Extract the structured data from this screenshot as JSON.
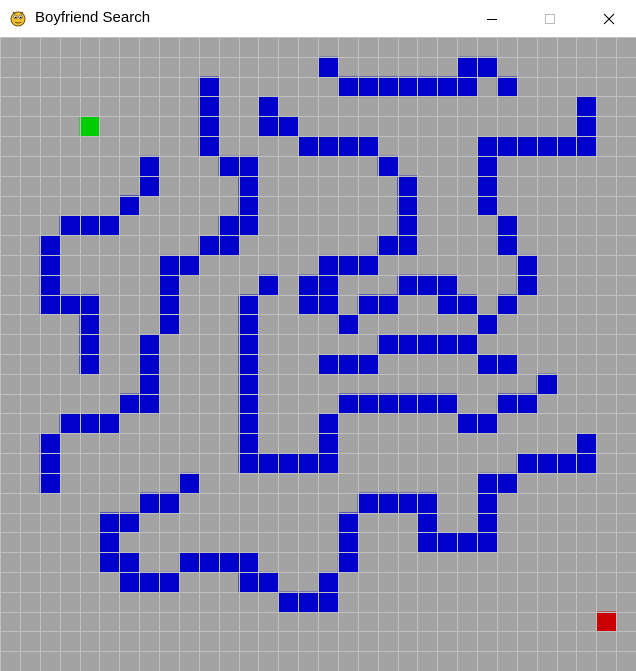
{
  "window": {
    "title": "Boyfriend Search",
    "icon": "pygame-snake-icon",
    "controls": [
      "minimize-icon",
      "maximize-icon",
      "close-icon"
    ]
  },
  "grid": {
    "columns": 32,
    "rows": 32,
    "colors": {
      "background": "#a3a3a3",
      "grid_lines": "#c0c0c0",
      "wall": "#0000cc",
      "start": "#00cc00",
      "goal": "#cc0000"
    },
    "start": [
      4,
      4
    ],
    "goal": [
      30,
      29
    ],
    "walls": [
      [
        16,
        1
      ],
      [
        23,
        1
      ],
      [
        24,
        1
      ],
      [
        17,
        2
      ],
      [
        18,
        2
      ],
      [
        19,
        2
      ],
      [
        20,
        2
      ],
      [
        21,
        2
      ],
      [
        22,
        2
      ],
      [
        23,
        2
      ],
      [
        25,
        2
      ],
      [
        10,
        2
      ],
      [
        10,
        3
      ],
      [
        10,
        4
      ],
      [
        10,
        5
      ],
      [
        13,
        3
      ],
      [
        13,
        4
      ],
      [
        14,
        4
      ],
      [
        29,
        3
      ],
      [
        29,
        4
      ],
      [
        15,
        5
      ],
      [
        16,
        5
      ],
      [
        17,
        5
      ],
      [
        18,
        5
      ],
      [
        24,
        5
      ],
      [
        25,
        5
      ],
      [
        26,
        5
      ],
      [
        27,
        5
      ],
      [
        28,
        5
      ],
      [
        29,
        5
      ],
      [
        11,
        6
      ],
      [
        12,
        6
      ],
      [
        19,
        6
      ],
      [
        24,
        6
      ],
      [
        7,
        6
      ],
      [
        7,
        7
      ],
      [
        12,
        7
      ],
      [
        20,
        7
      ],
      [
        24,
        7
      ],
      [
        6,
        8
      ],
      [
        12,
        8
      ],
      [
        20,
        8
      ],
      [
        24,
        8
      ],
      [
        3,
        9
      ],
      [
        4,
        9
      ],
      [
        5,
        9
      ],
      [
        11,
        9
      ],
      [
        12,
        9
      ],
      [
        20,
        9
      ],
      [
        25,
        9
      ],
      [
        2,
        10
      ],
      [
        10,
        10
      ],
      [
        11,
        10
      ],
      [
        19,
        10
      ],
      [
        20,
        10
      ],
      [
        25,
        10
      ],
      [
        2,
        11
      ],
      [
        8,
        11
      ],
      [
        9,
        11
      ],
      [
        16,
        11
      ],
      [
        17,
        11
      ],
      [
        18,
        11
      ],
      [
        26,
        11
      ],
      [
        2,
        12
      ],
      [
        8,
        12
      ],
      [
        13,
        12
      ],
      [
        15,
        12
      ],
      [
        16,
        12
      ],
      [
        20,
        12
      ],
      [
        21,
        12
      ],
      [
        22,
        12
      ],
      [
        26,
        12
      ],
      [
        2,
        13
      ],
      [
        3,
        13
      ],
      [
        4,
        13
      ],
      [
        8,
        13
      ],
      [
        12,
        13
      ],
      [
        15,
        13
      ],
      [
        16,
        13
      ],
      [
        18,
        13
      ],
      [
        19,
        13
      ],
      [
        22,
        13
      ],
      [
        23,
        13
      ],
      [
        25,
        13
      ],
      [
        4,
        14
      ],
      [
        8,
        14
      ],
      [
        12,
        14
      ],
      [
        17,
        14
      ],
      [
        24,
        14
      ],
      [
        4,
        15
      ],
      [
        7,
        15
      ],
      [
        12,
        15
      ],
      [
        19,
        15
      ],
      [
        20,
        15
      ],
      [
        21,
        15
      ],
      [
        22,
        15
      ],
      [
        23,
        15
      ],
      [
        4,
        16
      ],
      [
        7,
        16
      ],
      [
        12,
        16
      ],
      [
        16,
        16
      ],
      [
        17,
        16
      ],
      [
        18,
        16
      ],
      [
        24,
        16
      ],
      [
        25,
        16
      ],
      [
        7,
        17
      ],
      [
        12,
        17
      ],
      [
        27,
        17
      ],
      [
        6,
        18
      ],
      [
        7,
        18
      ],
      [
        12,
        18
      ],
      [
        17,
        18
      ],
      [
        18,
        18
      ],
      [
        19,
        18
      ],
      [
        20,
        18
      ],
      [
        21,
        18
      ],
      [
        22,
        18
      ],
      [
        25,
        18
      ],
      [
        26,
        18
      ],
      [
        3,
        19
      ],
      [
        4,
        19
      ],
      [
        5,
        19
      ],
      [
        12,
        19
      ],
      [
        16,
        19
      ],
      [
        23,
        19
      ],
      [
        24,
        19
      ],
      [
        2,
        20
      ],
      [
        12,
        20
      ],
      [
        16,
        20
      ],
      [
        29,
        20
      ],
      [
        2,
        21
      ],
      [
        12,
        21
      ],
      [
        13,
        21
      ],
      [
        14,
        21
      ],
      [
        15,
        21
      ],
      [
        16,
        21
      ],
      [
        26,
        21
      ],
      [
        27,
        21
      ],
      [
        28,
        21
      ],
      [
        29,
        21
      ],
      [
        2,
        22
      ],
      [
        9,
        22
      ],
      [
        24,
        22
      ],
      [
        25,
        22
      ],
      [
        7,
        23
      ],
      [
        8,
        23
      ],
      [
        18,
        23
      ],
      [
        19,
        23
      ],
      [
        20,
        23
      ],
      [
        21,
        23
      ],
      [
        24,
        23
      ],
      [
        5,
        24
      ],
      [
        6,
        24
      ],
      [
        17,
        24
      ],
      [
        21,
        24
      ],
      [
        24,
        24
      ],
      [
        5,
        25
      ],
      [
        17,
        25
      ],
      [
        21,
        25
      ],
      [
        22,
        25
      ],
      [
        23,
        25
      ],
      [
        24,
        25
      ],
      [
        5,
        26
      ],
      [
        6,
        26
      ],
      [
        9,
        26
      ],
      [
        10,
        26
      ],
      [
        11,
        26
      ],
      [
        12,
        26
      ],
      [
        17,
        26
      ],
      [
        6,
        27
      ],
      [
        7,
        27
      ],
      [
        8,
        27
      ],
      [
        12,
        27
      ],
      [
        13,
        27
      ],
      [
        16,
        27
      ],
      [
        14,
        28
      ],
      [
        15,
        28
      ],
      [
        16,
        28
      ]
    ]
  }
}
